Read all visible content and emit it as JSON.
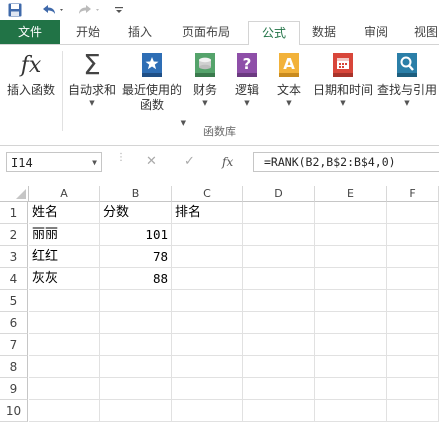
{
  "quick_access": {
    "save": "save-icon",
    "undo": "undo-icon",
    "redo": "redo-icon"
  },
  "tabs": [
    "文件",
    "开始",
    "插入",
    "页面布局",
    "公式",
    "数据",
    "审阅",
    "视图"
  ],
  "active_tab": "公式",
  "ribbon": {
    "buttons": [
      {
        "name": "insert-function-button",
        "label": "插入函数",
        "label2": "",
        "caret": false,
        "icon": "fx-icon"
      },
      {
        "name": "autosum-button",
        "label": "自动求和",
        "label2": "",
        "caret": true,
        "icon": "sigma-icon"
      },
      {
        "name": "recently-used-button",
        "label": "最近使用的",
        "label2": "函数",
        "caret": true,
        "icon": "star-book-icon"
      },
      {
        "name": "financial-button",
        "label": "财务",
        "label2": "",
        "caret": true,
        "icon": "coins-book-icon"
      },
      {
        "name": "logical-button",
        "label": "逻辑",
        "label2": "",
        "caret": true,
        "icon": "question-book-icon"
      },
      {
        "name": "text-button",
        "label": "文本",
        "label2": "",
        "caret": true,
        "icon": "text-book-icon"
      },
      {
        "name": "date-time-button",
        "label": "日期和时间",
        "label2": "",
        "caret": true,
        "icon": "calendar-book-icon"
      },
      {
        "name": "lookup-reference-button",
        "label": "查找与引用",
        "label2": "",
        "caret": true,
        "icon": "search-book-icon"
      }
    ],
    "group_label": "函数库"
  },
  "formula_bar": {
    "name_box": "I14",
    "cancel": "✕",
    "enter": "✓",
    "fx": "fx",
    "formula": "=RANK(B2,B$2:B$4,0)"
  },
  "columns": [
    "A",
    "B",
    "C",
    "D",
    "E",
    "F"
  ],
  "rows": [
    "1",
    "2",
    "3",
    "4",
    "5",
    "6",
    "7",
    "8",
    "9",
    "10"
  ],
  "cells": {
    "A1": "姓名",
    "B1": "分数",
    "C1": "排名",
    "A2": "丽丽",
    "B2": "101",
    "A3": "红红",
    "B3": "78",
    "A4": "灰灰",
    "B4": "88"
  },
  "colors": {
    "accent": "#217346"
  }
}
